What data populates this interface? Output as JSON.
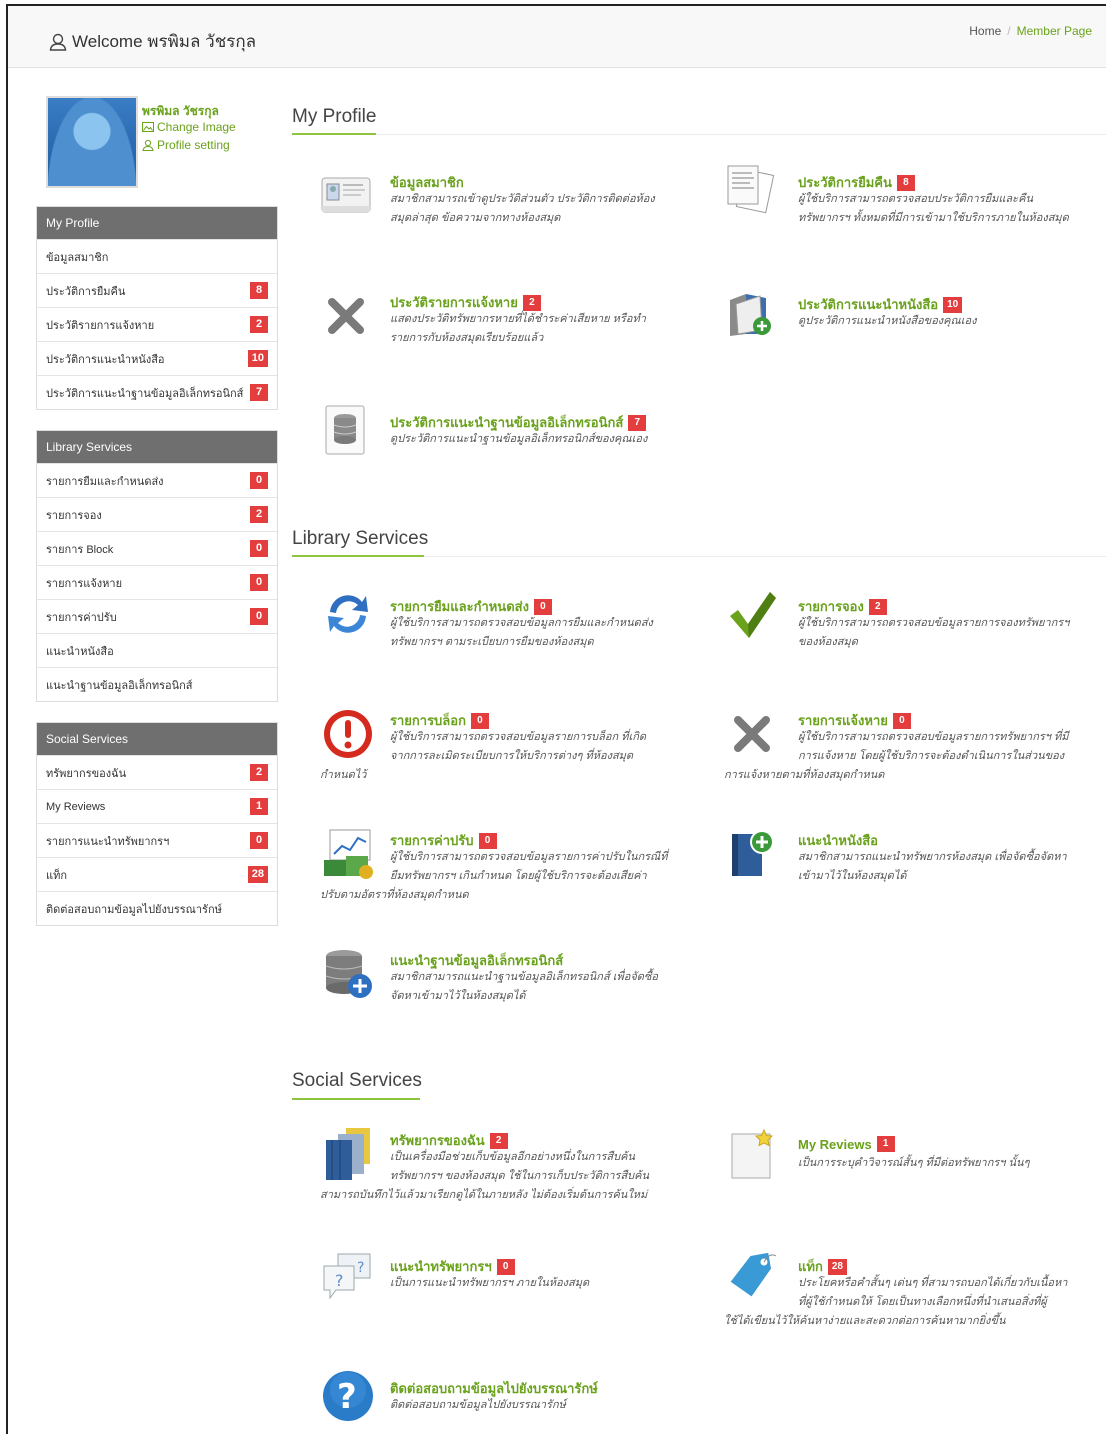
{
  "header": {
    "welcome": "Welcome พรพิมล วัชรกุล",
    "breadcrumb_home": "Home",
    "breadcrumb_sep": "/",
    "breadcrumb_active": "Member Page"
  },
  "profile": {
    "name": "พรพิมล วัชรกุล",
    "change_image": "Change Image",
    "profile_setting": "Profile setting"
  },
  "sidebar": {
    "my_profile": {
      "title": "My Profile",
      "items": [
        {
          "label": "ข้อมูลสมาชิก",
          "badge": ""
        },
        {
          "label": "ประวัติการยืมคืน",
          "badge": "8"
        },
        {
          "label": "ประวัติรายการแจ้งหาย",
          "badge": "2"
        },
        {
          "label": "ประวัติการแนะนำหนังสือ",
          "badge": "10"
        },
        {
          "label": "ประวัติการแนะนำฐานข้อมูลอิเล็กทรอนิกส์",
          "badge": "7"
        }
      ]
    },
    "library": {
      "title": "Library Services",
      "items": [
        {
          "label": "รายการยืมและกำหนดส่ง",
          "badge": "0"
        },
        {
          "label": "รายการจอง",
          "badge": "2"
        },
        {
          "label": "รายการ Block",
          "badge": "0"
        },
        {
          "label": "รายการแจ้งหาย",
          "badge": "0"
        },
        {
          "label": "รายการค่าปรับ",
          "badge": "0"
        },
        {
          "label": "แนะนำหนังสือ",
          "badge": ""
        },
        {
          "label": "แนะนำฐานข้อมูลอิเล็กทรอนิกส์",
          "badge": ""
        }
      ]
    },
    "social": {
      "title": "Social Services",
      "items": [
        {
          "label": "ทรัพยากรของฉัน",
          "badge": "2"
        },
        {
          "label": "My Reviews",
          "badge": "1"
        },
        {
          "label": "รายการแนะนำทรัพยากรฯ",
          "badge": "0"
        },
        {
          "label": "แท็ก",
          "badge": "28"
        },
        {
          "label": "ติดต่อสอบถามข้อมูลไปยังบรรณารักษ์",
          "badge": ""
        }
      ]
    }
  },
  "main": {
    "my_profile": {
      "title": "My Profile",
      "items": [
        {
          "title": "ข้อมูลสมาชิก",
          "badge": "",
          "icon": "id-card-icon",
          "desc": [
            "สมาชิกสามารถเข้าดูประวัติส่วนตัว ประวัติการติดต่อห้อง",
            "สมุดล่าสุด ข้อความจากทางห้องสมุด"
          ]
        },
        {
          "title": "ประวัติการยืมคืน",
          "badge": "8",
          "icon": "documents-icon",
          "desc": [
            "ผู้ใช้บริการสามารถตรวจสอบประวัติการยืมและคืน",
            "ทรัพยากรฯ ทั้งหมดที่มีการเข้ามาใช้บริการภายในห้องสมุด"
          ]
        },
        {
          "title": "ประวัติรายการแจ้งหาย",
          "badge": "2",
          "icon": "x-mark-icon",
          "desc": [
            "แสดงประวัติทรัพยากรหายที่ได้ชำระค่าเสียหาย หรือทำ",
            "รายการกับห้องสมุดเรียบร้อยแล้ว"
          ]
        },
        {
          "title": "ประวัติการแนะนำหนังสือ",
          "badge": "10",
          "icon": "book-add-icon",
          "desc": [
            "ดูประวัติการแนะนำหนังสือของคุณเอง"
          ]
        },
        {
          "title": "ประวัติการแนะนำฐานข้อมูลอิเล็กทรอนิกส์",
          "badge": "7",
          "icon": "database-doc-icon",
          "desc": [
            "ดูประวัติการแนะนำฐานข้อมูลอิเล็กทรอนิกส์ของคุณเอง"
          ]
        }
      ]
    },
    "library": {
      "title": "Library Services",
      "items": [
        {
          "title": "รายการยืมและกำหนดส่ง",
          "badge": "0",
          "icon": "refresh-icon",
          "desc": [
            "ผู้ใช้บริการสามารถตรวจสอบข้อมูลการยืมและกำหนดส่ง",
            "ทรัพยากรฯ ตามระเบียบการยืมของห้องสมุด"
          ]
        },
        {
          "title": "รายการจอง",
          "badge": "2",
          "icon": "checkmark-icon",
          "desc": [
            "ผู้ใช้บริการสามารถตรวจสอบข้อมูลรายการจองทรัพยากรฯ",
            "ของห้องสมุด"
          ]
        },
        {
          "title": "รายการบล็อก",
          "badge": "0",
          "icon": "alert-icon",
          "desc": [
            "ผู้ใช้บริการสามารถตรวจสอบข้อมูลรายการบล็อก ที่เกิด",
            "จากการละเมิดระเบียบการให้บริการต่างๆ ที่ห้องสมุด",
            "กำหนดไว้"
          ]
        },
        {
          "title": "รายการแจ้งหาย",
          "badge": "0",
          "icon": "x-mark-icon",
          "desc": [
            "ผู้ใช้บริการสามารถตรวจสอบข้อมูลรายการทรัพยากรฯ ที่มี",
            "การแจ้งหาย โดยผู้ใช้บริการจะต้องดำเนินการในส่วนของ",
            "การแจ้งหายตามที่ห้องสมุดกำหนด"
          ]
        },
        {
          "title": "รายการค่าปรับ",
          "badge": "0",
          "icon": "money-chart-icon",
          "desc": [
            "ผู้ใช้บริการสามารถตรวจสอบข้อมูลรายการค่าปรับในกรณีที่",
            "ยืมทรัพยากรฯ เกินกำหนด โดยผู้ใช้บริการจะต้องเสียค่า",
            "ปรับตามอัตราที่ห้องสมุดกำหนด"
          ]
        },
        {
          "title": "แนะนำหนังสือ",
          "badge": "",
          "icon": "book-plus-icon",
          "desc": [
            "สมาชิกสามารถแนะนำทรัพยากรห้องสมุด เพื่อจัดซื้อจัดหา",
            "เข้ามาไว้ในห้องสมุดได้"
          ]
        },
        {
          "title": "แนะนำฐานข้อมูลอิเล็กทรอนิกส์",
          "badge": "",
          "icon": "database-add-icon",
          "desc": [
            "สมาชิกสามารถแนะนำฐานข้อมูลอิเล็กทรอนิกส์ เพื่อจัดซื้อ",
            "จัดหาเข้ามาไว้ในห้องสมุดได้"
          ]
        }
      ]
    },
    "social": {
      "title": "Social Services",
      "items": [
        {
          "title": "ทรัพยากรของฉัน",
          "badge": "2",
          "icon": "folders-icon",
          "desc": [
            "เป็นเครื่องมือช่วยเก็บข้อมูลอีกอย่างหนึ่งในการสืบค้น",
            "ทรัพยากรฯ ของห้องสมุด ใช้ในการเก็บประวัติการสืบค้น",
            "สามารถบันทึกไว้แล้วมาเรียกดูได้ในภายหลัง ไม่ต้องเริ่มต้นการค้นใหม่"
          ]
        },
        {
          "title": "My Reviews",
          "badge": "1",
          "icon": "note-star-icon",
          "desc": [
            "เป็นการระบุคำวิจารณ์สั้นๆ ที่มีต่อทรัพยากรฯ นั้นๆ"
          ]
        },
        {
          "title": "แนะนำทรัพยากรฯ",
          "badge": "0",
          "icon": "question-bubbles-icon",
          "desc": [
            "เป็นการแนะนำทรัพยากรฯ ภายในห้องสมุด"
          ]
        },
        {
          "title": "แท็ก",
          "badge": "28",
          "icon": "tag-icon",
          "desc": [
            "ประโยคหรือคำสั้นๆ เด่นๆ ที่สามารถบอกได้เกี่ยวกับเนื้อหา",
            "ที่ผู้ใช้กำหนดให้ โดยเป็นทางเลือกหนึ่งที่นำเสนอสิ่งที่ผู้",
            "ใช้ได้เขียนไว้ให้ค้นหาง่ายและสะดวกต่อการค้นหามากยิ่งขึ้น"
          ]
        },
        {
          "title": "ติดต่อสอบถามข้อมูลไปยังบรรณารักษ์",
          "badge": "",
          "icon": "help-icon",
          "desc": [
            "ติดต่อสอบถามข้อมูลไปยังบรรณารักษ์"
          ]
        }
      ]
    }
  },
  "colors": {
    "accent": "#6aa21c",
    "badge": "#e43d3d",
    "panel_header": "#6f6f6f"
  }
}
